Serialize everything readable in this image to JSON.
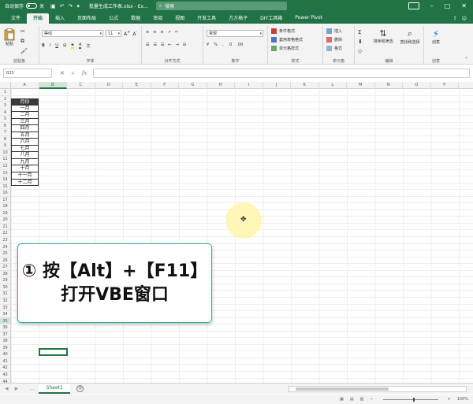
{
  "titlebar": {
    "autosave_label": "自动保存",
    "autosave_state": "关",
    "document_title": "批量生成工作表.xlsx - Ex...",
    "search_placeholder": "搜索"
  },
  "tabs": [
    "文件",
    "开始",
    "插入",
    "页面布局",
    "公式",
    "数据",
    "审阅",
    "视图",
    "开发工具",
    "方方格子",
    "DIY工具箱",
    "Power Pivot"
  ],
  "ribbon": {
    "clipboard": {
      "label": "剪贴板",
      "paste": "粘贴"
    },
    "font": {
      "label": "字体",
      "font_name": "等线",
      "font_size": "11"
    },
    "alignment": {
      "label": "对齐方式"
    },
    "number": {
      "label": "数字",
      "format": "常规"
    },
    "styles": {
      "label": "样式",
      "conditional": "条件格式",
      "table": "套用表格格式",
      "cell": "单元格样式"
    },
    "cells": {
      "label": "单元格",
      "insert": "插入",
      "delete": "删除",
      "format": "格式"
    },
    "editing": {
      "label": "编辑",
      "sort": "排序和筛选",
      "find": "查找和选择"
    },
    "ideas": {
      "label": "创意",
      "button": "创意"
    }
  },
  "formula_bar": {
    "name_box": "B35",
    "fx": "fx",
    "formula": ""
  },
  "columns": [
    "A",
    "B",
    "C",
    "D",
    "E",
    "F",
    "G",
    "H",
    "I",
    "J",
    "K",
    "L",
    "M",
    "N",
    "O",
    "P"
  ],
  "rows": [
    "1",
    "2",
    "3",
    "4",
    "5",
    "6",
    "7",
    "8",
    "9",
    "10",
    "11",
    "12",
    "13",
    "14",
    "15",
    "16",
    "17",
    "18",
    "19",
    "20",
    "21",
    "22",
    "23",
    "24",
    "25",
    "26",
    "27",
    "28",
    "29",
    "30",
    "31",
    "32",
    "33",
    "34",
    "35",
    "36",
    "37",
    "38",
    "39",
    "40",
    "41",
    "42",
    "43",
    "44"
  ],
  "data_list": {
    "header": "月份",
    "months": [
      "一月",
      "二月",
      "三月",
      "四月",
      "五月",
      "六月",
      "七月",
      "八月",
      "九月",
      "十月",
      "十一月",
      "十二月"
    ]
  },
  "callout": {
    "line1": "① 按【Alt】+【F11】",
    "line2": "打开VBE窗口"
  },
  "sheetbar": {
    "sheet_name": "Sheet1",
    "add_icon": "+"
  },
  "statusbar": {
    "zoom": "100%"
  }
}
